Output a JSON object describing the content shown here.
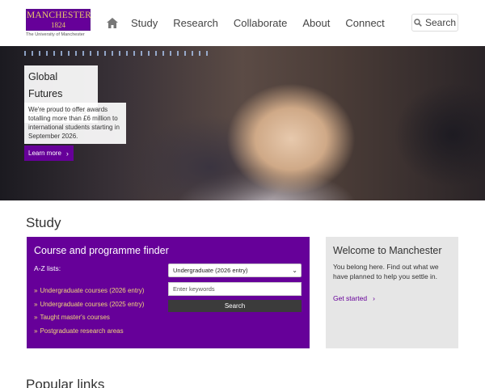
{
  "header": {
    "logo_word": "MANCHESTER",
    "logo_year": "1824",
    "logo_subtitle": "The University of Manchester",
    "nav": [
      "Study",
      "Research",
      "Collaborate",
      "About",
      "Connect"
    ],
    "search_label": "Search",
    "icons": {
      "home": "home-icon",
      "search": "search-icon"
    }
  },
  "hero": {
    "title": "Global Futures Scholarships",
    "description": "We're proud to offer awards totalling more than £6 million to international students starting in September 2026.",
    "cta": "Learn more"
  },
  "study": {
    "title": "Study",
    "finder": {
      "title": "Course and programme finder",
      "az_label": "A-Z lists:",
      "links": [
        "Undergraduate courses (2026 entry)",
        "Undergraduate courses (2025 entry)",
        "Taught master's courses",
        "Postgraduate research areas"
      ],
      "select_value": "Undergraduate (2026 entry)",
      "keyword_placeholder": "Enter keywords",
      "search_button": "Search"
    },
    "welcome": {
      "title": "Welcome to Manchester",
      "text": "You belong here. Find out what we have planned to help you settle in.",
      "link": "Get started"
    }
  },
  "popular": {
    "title": "Popular links"
  },
  "colors": {
    "brand_purple": "#660099",
    "accent_gold": "#f0d77a",
    "dark_button": "#3b3b3b",
    "panel_grey": "#e6e6e6"
  }
}
